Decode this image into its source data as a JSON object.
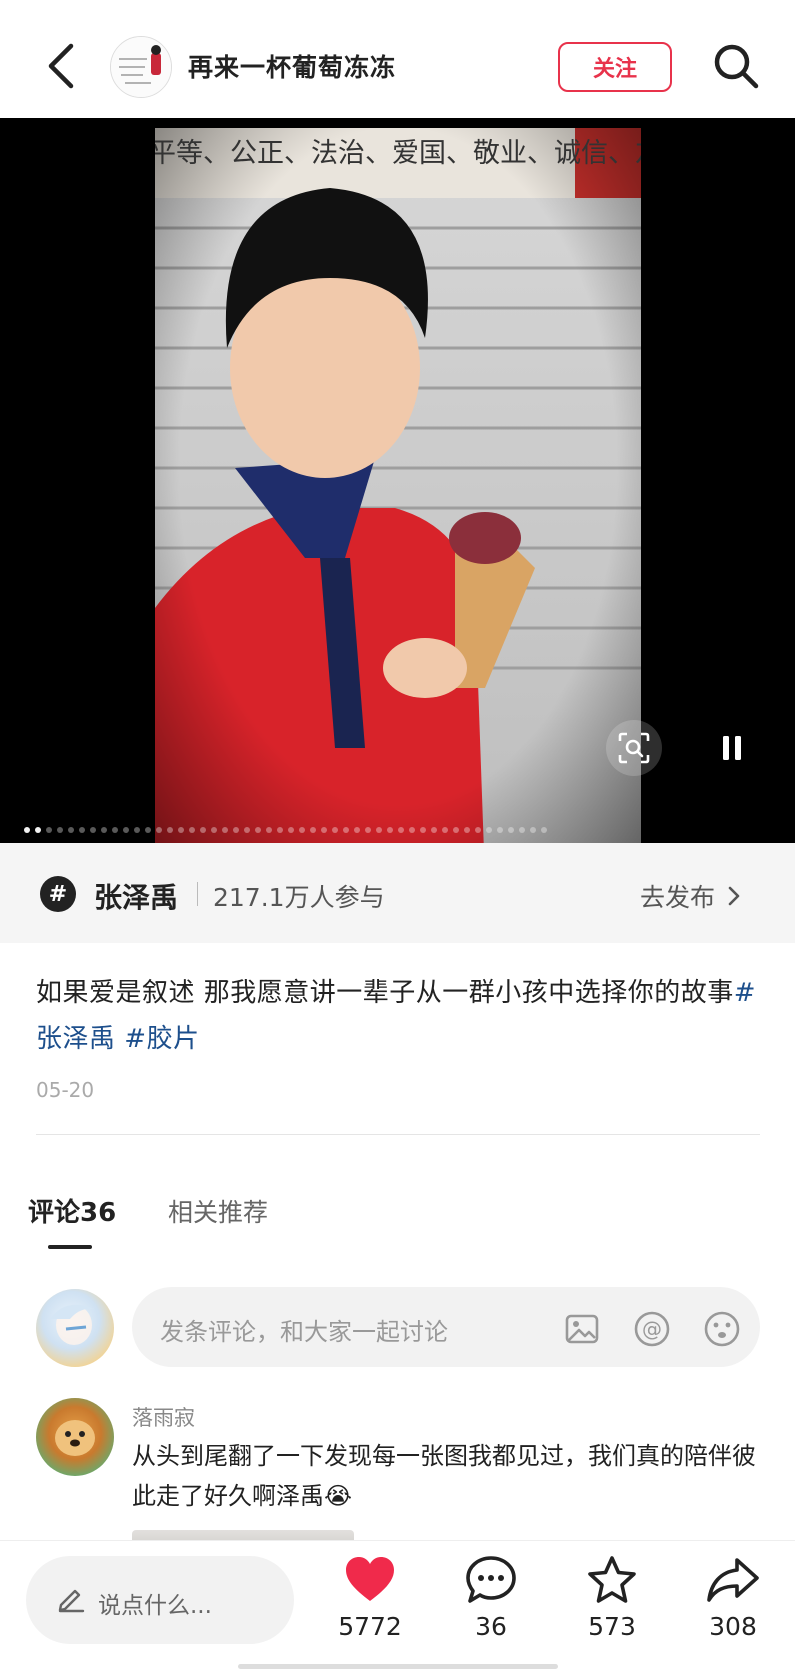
{
  "header": {
    "author_name": "再来一杯葡萄冻冻",
    "follow_label": "关注"
  },
  "topic": {
    "name": "张泽禹",
    "participants": "217.1万人参与",
    "action_label": "去发布"
  },
  "post": {
    "caption_text": "如果爱是叙述 那我愿意讲一辈子从一群小孩中选择你的故事",
    "hashtags": [
      "#张泽禹",
      "#胶片"
    ],
    "date": "05-20"
  },
  "tabs": {
    "comments": "评论36",
    "related": "相关推荐"
  },
  "comment_input": {
    "placeholder": "发条评论，和大家一起讨论"
  },
  "comments": [
    {
      "user": "落雨寂",
      "text": "从头到尾翻了一下发现每一张图我都见过，我们真的陪伴彼此走了好久啊泽禹😭"
    }
  ],
  "bottom_bar": {
    "say_placeholder": "说点什么...",
    "likes": "5772",
    "comments": "36",
    "favorites": "573",
    "shares": "308"
  },
  "media": {
    "photo_banner_text": "平等、公正、法治、爱国、敬业、诚信、友善",
    "total_slides": 48,
    "current_slide": 2
  },
  "colors": {
    "accent": "#e8324b",
    "hashtag": "#1d4f8c",
    "like": "#f02a4b"
  }
}
